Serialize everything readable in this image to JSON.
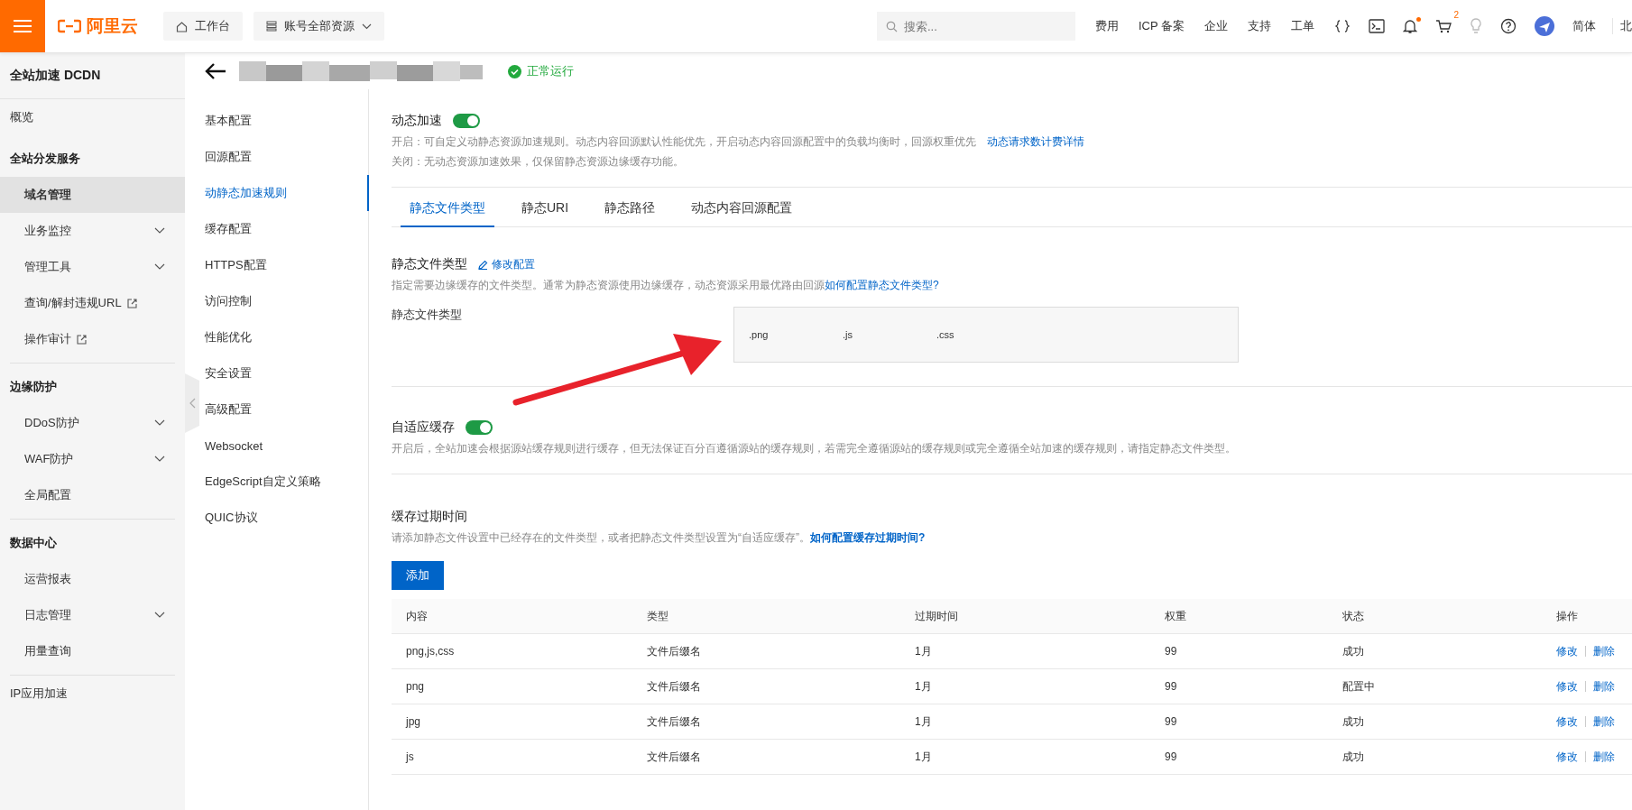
{
  "topbar": {
    "logo": "阿里云",
    "workbench": "工作台",
    "resources": "账号全部资源",
    "search": {
      "placeholder": "搜索..."
    },
    "links": [
      "费用",
      "ICP 备案",
      "企业",
      "支持",
      "工单"
    ],
    "cart_badge": "2",
    "notification_dot": true,
    "language": "简体",
    "region": "北"
  },
  "sidebar": {
    "title": "全站加速 DCDN",
    "sections": [
      {
        "kind": "link",
        "label": "概览"
      },
      {
        "kind": "group",
        "label": "全站分发服务",
        "children": [
          {
            "label": "域名管理",
            "kind": "plain",
            "selected": true
          },
          {
            "label": "业务监控",
            "kind": "expandable",
            "selected": false
          },
          {
            "label": "管理工具",
            "kind": "expandable",
            "selected": false
          },
          {
            "label": "查询/解封违规URL",
            "kind": "external",
            "selected": false
          },
          {
            "label": "操作审计",
            "kind": "external",
            "selected": false
          }
        ]
      },
      {
        "kind": "group",
        "label": "边缘防护",
        "children": [
          {
            "label": "DDoS防护",
            "kind": "expandable",
            "selected": false
          },
          {
            "label": "WAF防护",
            "kind": "expandable",
            "selected": false
          },
          {
            "label": "全局配置",
            "kind": "plain",
            "selected": false
          }
        ]
      },
      {
        "kind": "group",
        "label": "数据中心",
        "children": [
          {
            "label": "运营报表",
            "kind": "plain",
            "selected": false
          },
          {
            "label": "日志管理",
            "kind": "expandable",
            "selected": false
          },
          {
            "label": "用量查询",
            "kind": "plain",
            "selected": false
          }
        ]
      },
      {
        "kind": "link",
        "label": "IP应用加速"
      }
    ]
  },
  "subnav": [
    {
      "label": "基本配置",
      "selected": false
    },
    {
      "label": "回源配置",
      "selected": false
    },
    {
      "label": "动静态加速规则",
      "selected": true
    },
    {
      "label": "缓存配置",
      "selected": false
    },
    {
      "label": "HTTPS配置",
      "selected": false
    },
    {
      "label": "访问控制",
      "selected": false
    },
    {
      "label": "性能优化",
      "selected": false
    },
    {
      "label": "安全设置",
      "selected": false
    },
    {
      "label": "高级配置",
      "selected": false
    },
    {
      "label": "Websocket",
      "selected": false
    },
    {
      "label": "EdgeScript自定义策略",
      "selected": false
    },
    {
      "label": "QUIC协议",
      "selected": false
    }
  ],
  "header": {
    "status": "正常运行"
  },
  "dynamic_acceleration": {
    "label": "动态加速",
    "on": true,
    "description_on": "开启：可自定义动静态资源加速规则。动态内容回源默认性能优先，开启动态内容回源配置中的负载均衡时，回源权重优先",
    "link": "动态请求数计费详情",
    "description_off": "关闭：无动态资源加速效果，仅保留静态资源边缘缓存功能。"
  },
  "tabs": [
    {
      "label": "静态文件类型",
      "selected": true
    },
    {
      "label": "静态URI",
      "selected": false
    },
    {
      "label": "静态路径",
      "selected": false
    },
    {
      "label": "动态内容回源配置",
      "selected": false
    }
  ],
  "static_types": {
    "title": "静态文件类型",
    "edit_link": "修改配置",
    "description": "指定需要边缘缓存的文件类型。通常为静态资源使用边缘缓存，动态资源采用最优路由回源",
    "help_link": "如何配置静态文件类型?",
    "field_label": "静态文件类型",
    "values": [
      ".png",
      ".js",
      ".css"
    ]
  },
  "adaptive_cache": {
    "label": "自适应缓存",
    "on": true,
    "description": "开启后，全站加速会根据源站缓存规则进行缓存，但无法保证百分百遵循源站的缓存规则，若需完全遵循源站的缓存规则或完全遵循全站加速的缓存规则，请指定静态文件类型。"
  },
  "expiry": {
    "title": "缓存过期时间",
    "description": "请添加静态文件设置中已经存在的文件类型，或者把静态文件类型设置为“自适应缓存”。",
    "help_link": "如何配置缓存过期时间?",
    "add_button": "添加",
    "columns": [
      "内容",
      "类型",
      "过期时间",
      "权重",
      "状态",
      "操作"
    ],
    "rows": [
      {
        "cells": [
          "png,js,css",
          "文件后缀名",
          "1月",
          "99",
          "成功"
        ],
        "actions": [
          "修改",
          "删除"
        ]
      },
      {
        "cells": [
          "png",
          "文件后缀名",
          "1月",
          "99",
          "配置中"
        ],
        "actions": [
          "修改",
          "删除"
        ]
      },
      {
        "cells": [
          "jpg",
          "文件后缀名",
          "1月",
          "99",
          "成功"
        ],
        "actions": [
          "修改",
          "删除"
        ]
      },
      {
        "cells": [
          "js",
          "文件后缀名",
          "1月",
          "99",
          "成功"
        ],
        "actions": [
          "修改",
          "删除"
        ]
      }
    ]
  }
}
